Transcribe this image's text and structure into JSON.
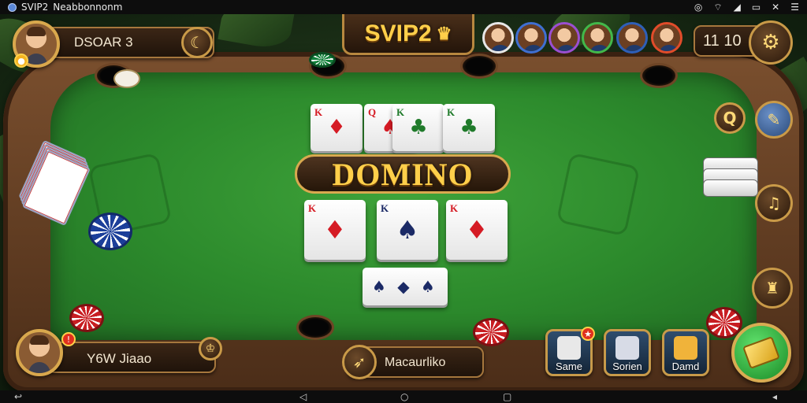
{
  "status_bar": {
    "app_title": "SVIP2",
    "app_subtitle": "Neabbonnonm",
    "icons": [
      "app-icon",
      "alarm-icon",
      "wifi-icon",
      "signal-icon",
      "battery-icon",
      "close-icon",
      "menu-icon"
    ]
  },
  "top": {
    "player_name": "DSOAR 3",
    "logo": "SVIP2",
    "score": "11 10",
    "opponents": [
      {
        "name": "opponent-1",
        "ring": "#e7e7e7"
      },
      {
        "name": "opponent-2",
        "ring": "#3f6fd1"
      },
      {
        "name": "opponent-3",
        "ring": "#9b4fd1"
      },
      {
        "name": "opponent-4",
        "ring": "#42b84a"
      },
      {
        "name": "opponent-5",
        "ring": "#2e5fb8"
      },
      {
        "name": "opponent-6",
        "ring": "#e14c2a"
      }
    ]
  },
  "side_buttons": {
    "top_right_label": "Q",
    "icons": [
      "settings-gear-icon",
      "chat-icon",
      "mute-icon",
      "music-icon",
      "tournament-icon"
    ]
  },
  "table": {
    "title": "DOMINO",
    "top_cards": [
      {
        "rank": "K",
        "suit": "♦",
        "color": "red"
      },
      {
        "rank": "Q",
        "suit": "♠",
        "color": "red"
      },
      {
        "rank": "K",
        "suit": "♣",
        "color": "green"
      },
      {
        "rank": "K",
        "suit": "♣",
        "color": "green"
      }
    ],
    "mid_cards": [
      {
        "rank": "K",
        "suit": "♦",
        "color": "red"
      },
      {
        "rank": "K",
        "suit": "♠",
        "color": "navy"
      },
      {
        "rank": "K",
        "suit": "♦",
        "color": "red"
      }
    ],
    "bottom_card": {
      "rank": "",
      "suit": "♠ ◆ ♠",
      "color": "navy"
    }
  },
  "bottom": {
    "player_name": "Y6W Jiaao",
    "center_label": "Macaurliko",
    "actions": [
      {
        "label": "Same",
        "icon": "dice-icon",
        "badge": "★"
      },
      {
        "label": "Sorien",
        "icon": "domino-tile-icon",
        "badge": ""
      },
      {
        "label": "Damd",
        "icon": "trophy-icon",
        "badge": ""
      }
    ],
    "play_icon": "play-tile-icon"
  },
  "nav_bar": {
    "icons": [
      "back-icon",
      "home-icon",
      "recents-icon",
      "screenshot-icon",
      "volume-icon"
    ]
  }
}
